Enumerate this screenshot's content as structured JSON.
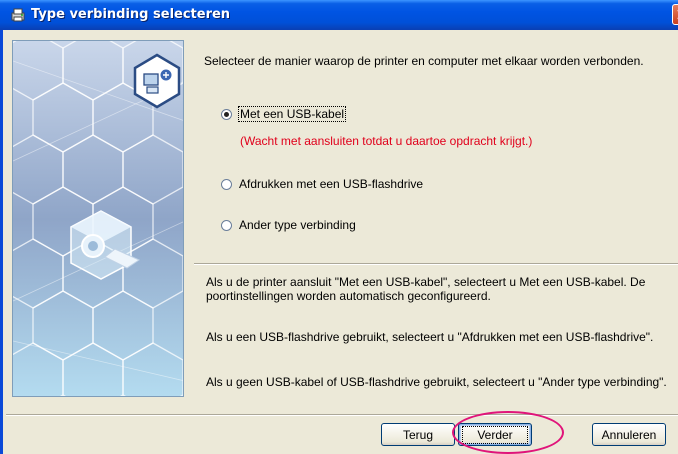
{
  "window": {
    "title": "Type verbinding selecteren",
    "title_icon": "printer-setup-icon",
    "accent": "#0054e3"
  },
  "intro": "Selecteer de manier waarop de printer en computer met elkaar worden verbonden.",
  "options": [
    {
      "label": "Met een USB-kabel",
      "selected": true
    },
    {
      "label": "Afdrukken met een USB-flashdrive",
      "selected": false
    },
    {
      "label": "Ander type verbinding",
      "selected": false
    }
  ],
  "warning": "(Wacht met aansluiten totdat u daartoe opdracht krijgt.)",
  "warning_color": "#e0001b",
  "descriptions": {
    "usb": "Als u de printer aansluit \"Met een USB-kabel\", selecteert u Met een USB-kabel. De poortinstellingen worden automatisch geconfigureerd.",
    "flashdrive": "Als u een USB-flashdrive gebruikt, selecteert u \"Afdrukken met een USB-flashdrive\".",
    "other": "Als u geen USB-kabel of USB-flashdrive gebruikt, selecteert u \"Ander type verbinding\"."
  },
  "buttons": {
    "back": "Terug",
    "next": "Verder",
    "cancel": "Annuleren"
  },
  "highlight_color": "#e0147a"
}
